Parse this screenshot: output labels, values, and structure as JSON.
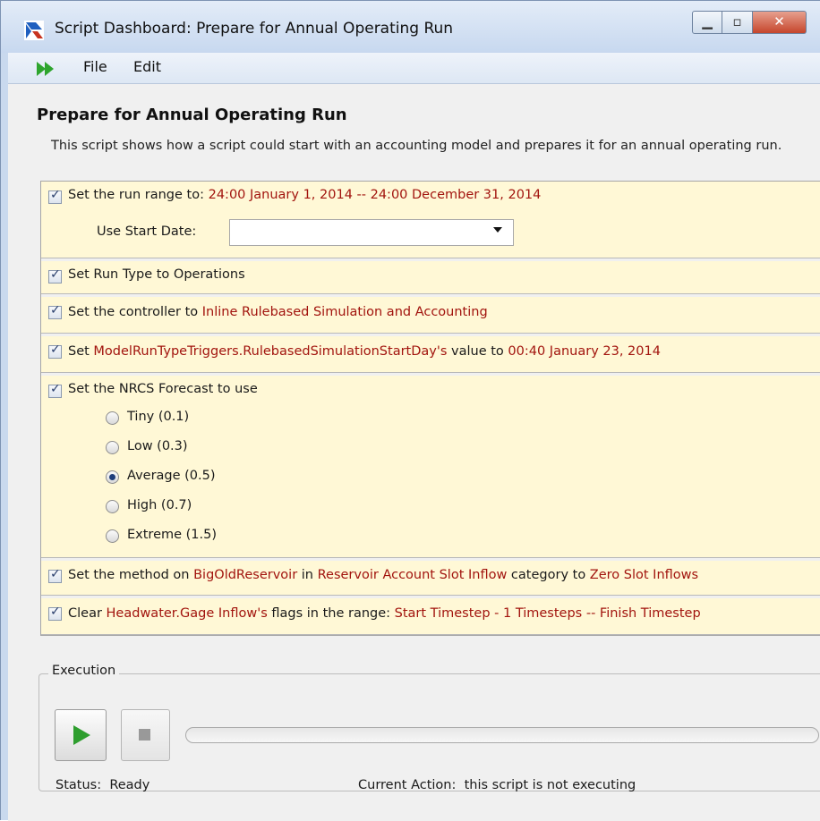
{
  "window": {
    "title": "Script Dashboard: Prepare for Annual Operating Run"
  },
  "menu": {
    "file": "File",
    "edit": "Edit"
  },
  "script": {
    "title": "Prepare for Annual Operating Run",
    "description": "This script shows how a script could start with an accounting model and prepares it for an annual operating run."
  },
  "steps": [
    {
      "checked": true,
      "parts": [
        "Set the run range to: ",
        "24:00 January 1, 2014 -- 24:00 December 31, 2014"
      ],
      "start_date_label": "Use Start Date:",
      "start_date_value": ""
    },
    {
      "checked": true,
      "parts": [
        "Set Run Type to Operations"
      ]
    },
    {
      "checked": true,
      "parts": [
        "Set the controller to ",
        "Inline Rulebased Simulation and Accounting"
      ]
    },
    {
      "checked": true,
      "parts": [
        "Set ",
        "ModelRunTypeTriggers.RulebasedSimulationStartDay's",
        " value to ",
        "00:40 January 23, 2014"
      ]
    },
    {
      "checked": true,
      "parts": [
        "Set the NRCS Forecast to use"
      ],
      "options": [
        {
          "label": "Tiny (0.1)",
          "selected": false
        },
        {
          "label": "Low (0.3)",
          "selected": false
        },
        {
          "label": "Average (0.5)",
          "selected": true
        },
        {
          "label": "High (0.7)",
          "selected": false
        },
        {
          "label": "Extreme (1.5)",
          "selected": false
        }
      ]
    },
    {
      "checked": true,
      "parts": [
        "Set the method on ",
        "BigOldReservoir",
        " in ",
        "Reservoir Account Slot Inflow",
        " category to ",
        "Zero Slot Inflows"
      ]
    },
    {
      "checked": true,
      "parts": [
        "Clear ",
        "Headwater.Gage Inflow's",
        " flags in the range: ",
        "Start Timestep - 1 Timesteps -- Finish Timestep"
      ]
    }
  ],
  "execution": {
    "group_label": "Execution",
    "progress": 0,
    "status_label": "Status:",
    "status_value": "Ready",
    "current_action_label": "Current Action:",
    "current_action_value": "this script is not executing"
  },
  "icons": {
    "app": "riverware-r-icon",
    "run": "run-arrows-icon",
    "play": "play-icon",
    "stop": "stop-icon"
  },
  "colors": {
    "highlight_text": "#a2140e",
    "step_background": "#fff8d6",
    "play_green": "#2e9e2e"
  }
}
